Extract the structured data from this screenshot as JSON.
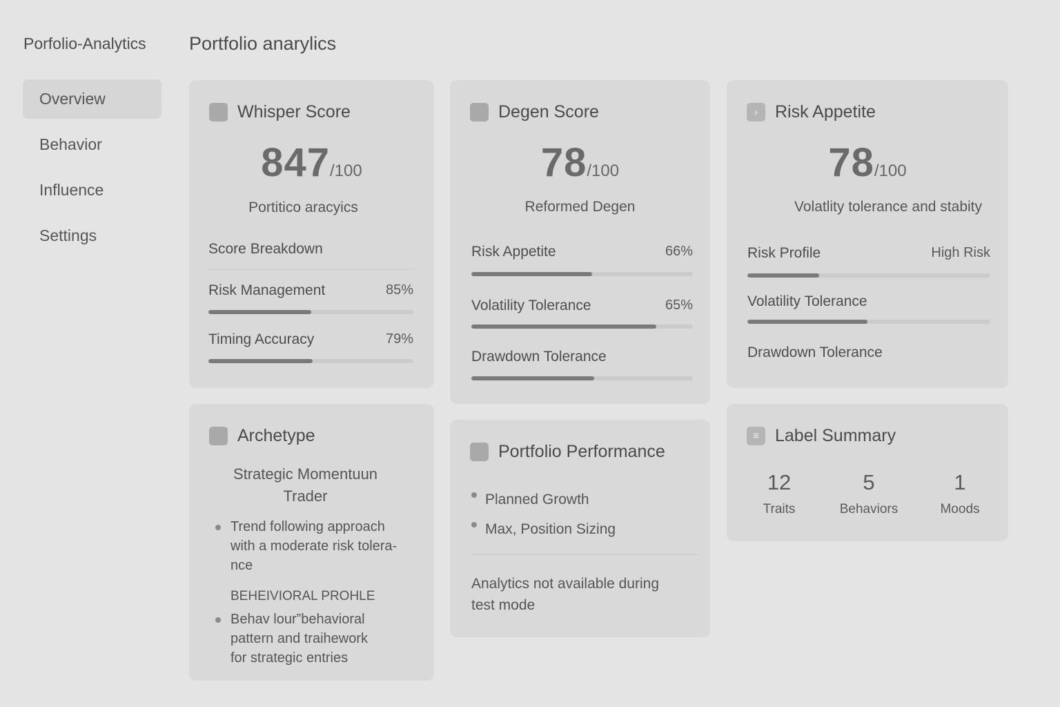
{
  "app": {
    "title": "Porfolio-Analytics",
    "page_title": "Portfolio anarylics"
  },
  "sidebar": {
    "items": [
      {
        "label": "Overview",
        "active": true
      },
      {
        "label": "Behavior"
      },
      {
        "label": "Influence"
      },
      {
        "label": "Settings"
      }
    ]
  },
  "whisper": {
    "title": "Whisper Score",
    "score": "847",
    "denom": "/100",
    "subtitle": "Portitico aracyics",
    "breakdown_label": "Score Breakdown",
    "metrics": [
      {
        "label": "Risk Management",
        "value": "85%",
        "fill": 0.5
      },
      {
        "label": "Timing Accuracy",
        "value": "79%",
        "fill": 0.51
      }
    ]
  },
  "degen": {
    "title": "Degen Score",
    "score": "78",
    "denom": "/100",
    "subtitle": "Reformed Degen",
    "metrics": [
      {
        "label": "Risk Appetite",
        "value": "66%",
        "fill": 0.545
      },
      {
        "label": "Volatility Tolerance",
        "value": "65%",
        "fill": 0.835
      },
      {
        "label": "Drawdown Tolerance",
        "value": "",
        "fill": 0.555
      }
    ]
  },
  "risk": {
    "title": "Risk Appetite",
    "icon": "chevron-right-icon",
    "score": "78",
    "denom": "/100",
    "subtitle": "Volatlity tolerance and stabity",
    "metrics": [
      {
        "label": "Risk Profile",
        "value": "High Risk",
        "fill": 0.295
      },
      {
        "label": "Volatility Tolerance",
        "value": "",
        "fill": 0.495
      },
      {
        "label": "Drawdown Tolerance",
        "value": ""
      }
    ]
  },
  "archetype": {
    "title": "Archetype",
    "name_line1": "Strategic Momentuun",
    "name_line2": "Trader",
    "bullet1_l1": "Trend following approach",
    "bullet1_l2": "with a moderate risk tolera-",
    "bullet1_l3": "nce",
    "section_label": "BEHEIVIORAL PROHLE",
    "bullet2_l1": "Behav lour”behavioral",
    "bullet2_l2": "pattern and traihework",
    "bullet2_l3": "for strategic entries"
  },
  "performance": {
    "title": "Portfolio Performance",
    "items": [
      "Planned Growth",
      "Max, Position Sizing"
    ],
    "note_l1": "Analytics not available during",
    "note_l2": "test mode"
  },
  "labels": {
    "title": "Label Summary",
    "icon": "list-icon",
    "stats": [
      {
        "num": "12",
        "label": "Traits"
      },
      {
        "num": "5",
        "label": "Behaviors"
      },
      {
        "num": "1",
        "label": "Moods"
      }
    ]
  },
  "colors": {
    "background": "#e4e4e4",
    "card": "#d9d9d9",
    "bar_fill": "#7a7a7a",
    "bar_track": "#cbcbcb"
  }
}
